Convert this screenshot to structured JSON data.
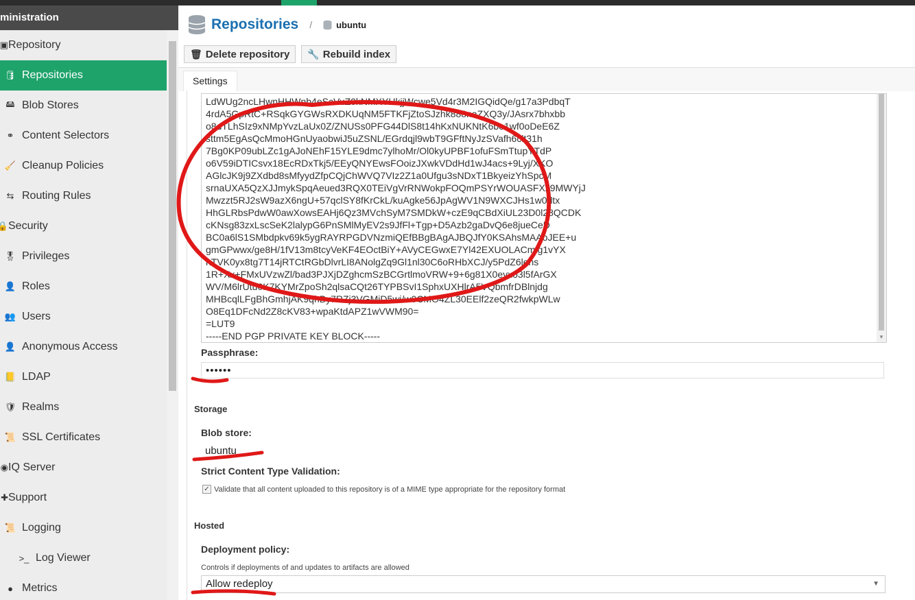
{
  "sidebar": {
    "header": "ministration",
    "items": [
      {
        "label": "Repository",
        "icon": "repository-icon",
        "level": 0,
        "active": false
      },
      {
        "label": "Repositories",
        "icon": "database-icon",
        "level": 1,
        "active": true
      },
      {
        "label": "Blob Stores",
        "icon": "server-icon",
        "level": 1,
        "active": false
      },
      {
        "label": "Content Selectors",
        "icon": "link-icon",
        "level": 1,
        "active": false
      },
      {
        "label": "Cleanup Policies",
        "icon": "broom-icon",
        "level": 1,
        "active": false
      },
      {
        "label": "Routing Rules",
        "icon": "route-icon",
        "level": 1,
        "active": false
      },
      {
        "label": "Security",
        "icon": "security-icon",
        "level": 0,
        "active": false
      },
      {
        "label": "Privileges",
        "icon": "badge-icon",
        "level": 1,
        "active": false
      },
      {
        "label": "Roles",
        "icon": "roles-icon",
        "level": 1,
        "active": false
      },
      {
        "label": "Users",
        "icon": "users-icon",
        "level": 1,
        "active": false
      },
      {
        "label": "Anonymous Access",
        "icon": "user-icon",
        "level": 1,
        "active": false
      },
      {
        "label": "LDAP",
        "icon": "book-icon",
        "level": 1,
        "active": false
      },
      {
        "label": "Realms",
        "icon": "shield-icon",
        "level": 1,
        "active": false
      },
      {
        "label": "SSL Certificates",
        "icon": "certificate-icon",
        "level": 1,
        "active": false
      },
      {
        "label": "IQ Server",
        "icon": "iq-icon",
        "level": 0,
        "active": false
      },
      {
        "label": "Support",
        "icon": "support-icon",
        "level": 0,
        "active": false
      },
      {
        "label": "Logging",
        "icon": "scroll-icon",
        "level": 1,
        "active": false
      },
      {
        "label": "Log Viewer",
        "icon": "terminal-icon",
        "level": 2,
        "active": false
      },
      {
        "label": "Metrics",
        "icon": "metrics-icon",
        "level": 1,
        "active": false
      }
    ]
  },
  "breadcrumb": {
    "title": "Repositories",
    "separator": "/",
    "current": "ubuntu"
  },
  "toolbar": {
    "delete_label": "Delete repository",
    "rebuild_label": "Rebuild index"
  },
  "tabs": {
    "settings": "Settings"
  },
  "key": {
    "lines": [
      "LdWUg2ncLHwnHHWnb4eScVuZ0kNMXYHkjjWcwe5Vd4r3M2IGQidQe/g17a3PdbqT",
      "4rdA5GpRtC+RSqkGYGWsRXDKUqNM5FTKFjZtoSJzhk888naZXQ3y/JAsrx7bhxbb",
      "o8dTLhSIz9xNMpYvzLaUx0Z/ZNUSs0PFG44DlS8t14hKxNUKNtK6bo1wf0oDeE6Z",
      "sttm5EgAsQcMmoHGnUyaobwiJ5uZSNL/EGrdqjl9wbT9GFftNyJzSVafh6clt31h",
      "7Bg0KP09ubLZc1gAJoNEhF15YLE9dmc7ylhoMr/Ol0kyUPBF1ofuFSmTtupYTdP",
      "o6V59iDTICsvx18EcRDxTkj5/EEyQNYEwsFOoizJXwkVDdHd1wJ4acs+9Lyj/XKO",
      "AGlcJK9j9ZXdbd8sMfyydZfpCQjChWVQ7VIz2Z1a0Ufgu3sNDxT1BkyeizYhSpcM",
      "srnaUXA5QzXJJmykSpqAeued3RQX0TEiVgVrRNWokpFOQmPSYrWOUASFXz9MWYjJ",
      "Mwzzt5RJ2sW9azX6ngU+57qclSY8fKrCkL/kuAgke56JpAgWV1N9WXCJHs1w0dtx",
      "HhGLRbsPdwW0awXowsEAHj6Qz3MVchSyM7SMDkW+czE9qCBdXiUL23D0l28QCDK",
      "cKNsg83zxLscSeK2lalypG6PnSMlMyEV2s9JfFl+Tgp+D5Azb2gaDvQ6e8jueCeD",
      "BC0a6lS1SMbdpkv69k5ygRAYRPGDVNzmiQEfBBgBAgAJBQJfY0KSAhsMAAoJEE+u",
      "gmGPwwx/ge8H/1fV13m8tcyVeKF4EOctBiY+AVyCEGwxE7Yl42EXUOLACmlg1vYX",
      "nTVK0yx8tg7T14jRTCtRGbDlvrLI8ANolgZq9Gl1nl30C6oRHbXCJ/y5PdZ6lehs",
      "1R+Xx+FMxUVzwZl/bad3PJXjDZghcmSzBCGrtlmoVRW+9+6g81X0eyxo3l5fArGX",
      "WV/M6lrUtu0K7KYMrZpoSh2qlsaCQt26TYPBSvI1SphxUXHlrA5VQbmfrDBlnjdg",
      "MHBcqlLFgBhGmhjAK9qhBy7RZj3VGMiD5wi/w0CMO4ZL30EElf2zeQR2fwkpWLw",
      "O8Eq1DFcNd2Z8cKV83+wpaKtdAPZ1wVWM90=",
      "=LUT9",
      "-----END PGP PRIVATE KEY BLOCK-----"
    ]
  },
  "passphrase": {
    "label": "Passphrase:",
    "value": "••••••"
  },
  "storage": {
    "section": "Storage",
    "blob_label": "Blob store:",
    "blob_value": "ubuntu",
    "strict_label": "Strict Content Type Validation:",
    "strict_checked": true,
    "strict_text": "Validate that all content uploaded to this repository is of a MIME type appropriate for the repository format"
  },
  "hosted": {
    "section": "Hosted",
    "policy_label": "Deployment policy:",
    "policy_help": "Controls if deployments of and updates to artifacts are allowed",
    "policy_value": "Allow redeploy"
  },
  "colors": {
    "accent": "#1ea36b",
    "link": "#1a6fb0",
    "annotation": "#e01818"
  }
}
